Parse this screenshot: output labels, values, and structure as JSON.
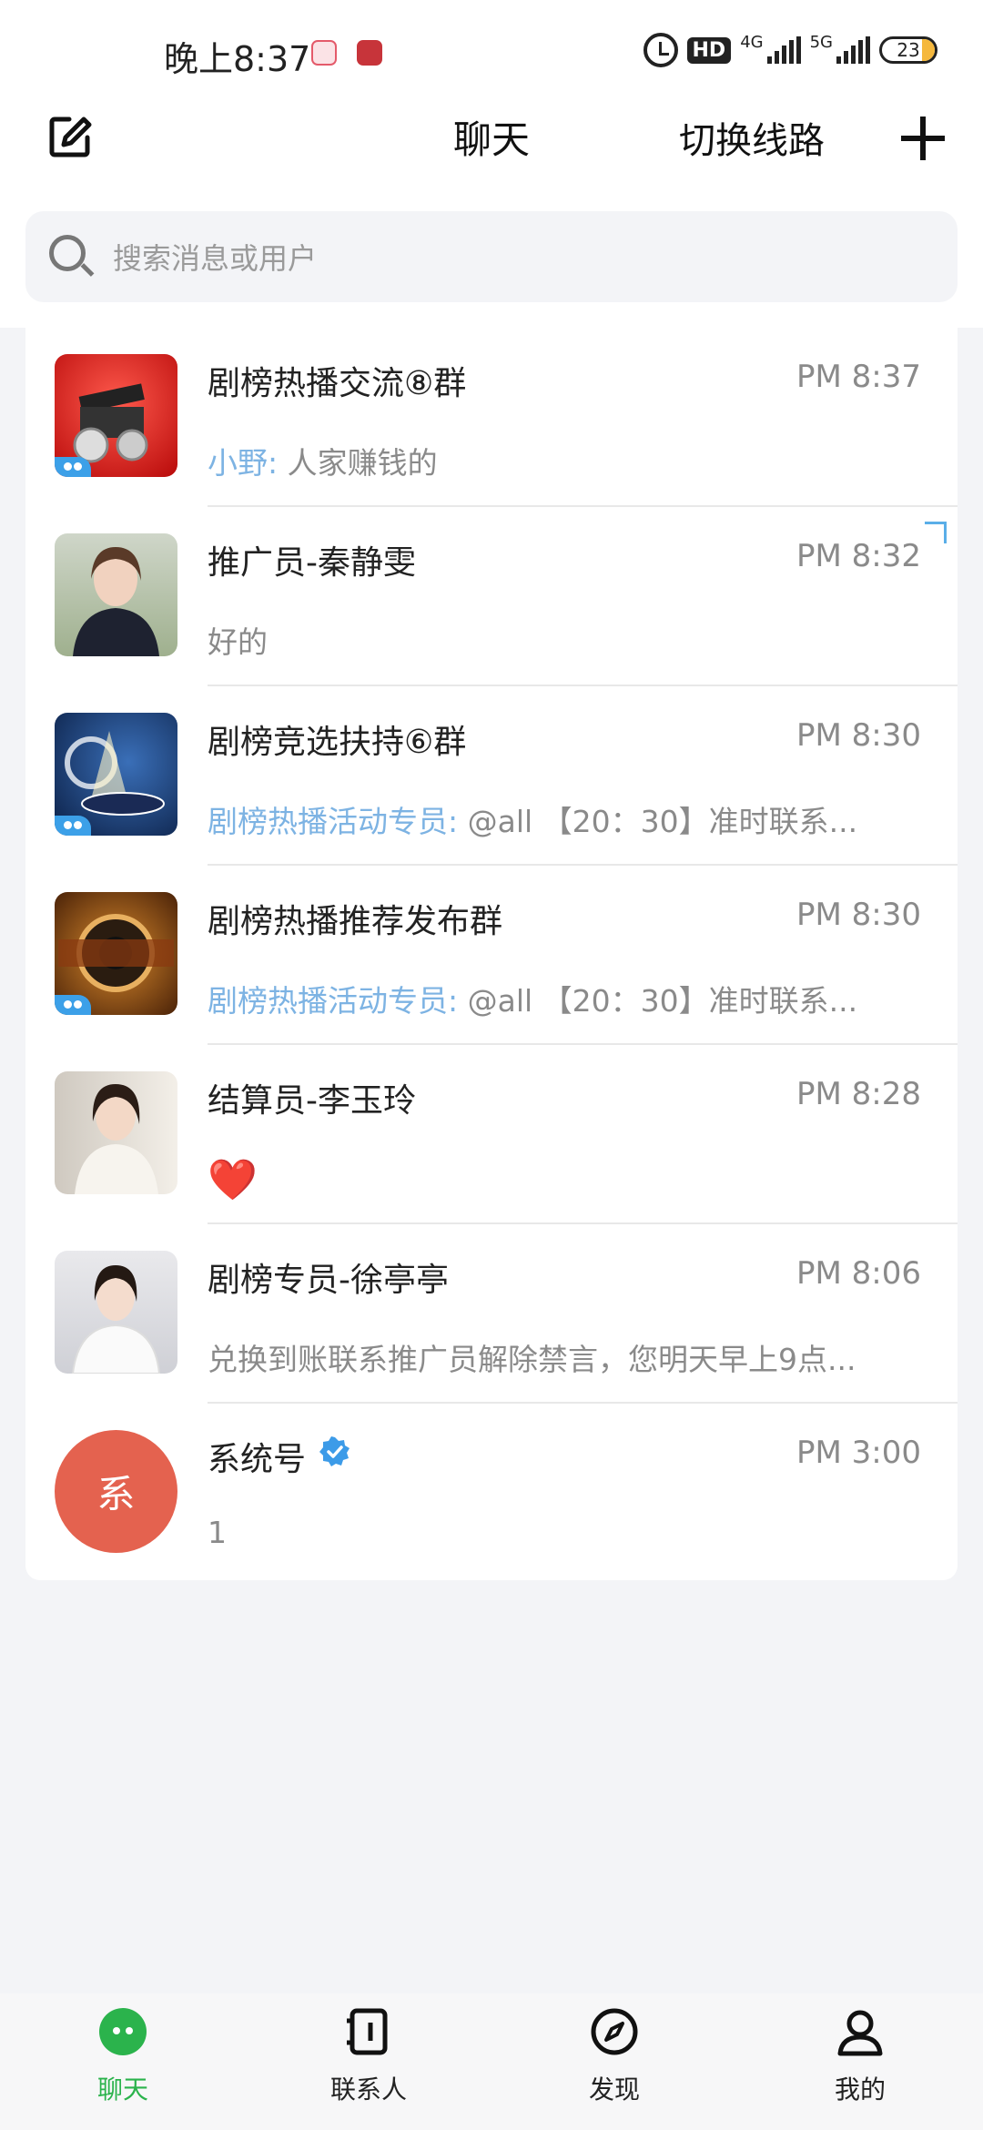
{
  "status_bar": {
    "time": "晚上8:37",
    "hd": "HD",
    "net1": "4G",
    "net2": "5G",
    "battery": "23"
  },
  "header": {
    "title": "聊天",
    "switch_route": "切换线路"
  },
  "search": {
    "placeholder": "搜索消息或用户"
  },
  "chats": [
    {
      "name": "剧榜热播交流⑧群",
      "time": "PM 8:37",
      "sender": "小野: ",
      "preview": "人家赚钱的"
    },
    {
      "name": "推广员-秦静雯",
      "time": "PM 8:32",
      "sender": "",
      "preview": "好的"
    },
    {
      "name": "剧榜竞选扶持⑥群",
      "time": "PM 8:30",
      "sender": "剧榜热播活动专员: ",
      "preview": "@all 【20：30】准时联系..."
    },
    {
      "name": "剧榜热播推荐发布群",
      "time": "PM 8:30",
      "sender": "剧榜热播活动专员: ",
      "preview": "@all 【20：30】准时联系..."
    },
    {
      "name": "结算员-李玉玲",
      "time": "PM 8:28",
      "sender": "",
      "preview": "❤️"
    },
    {
      "name": "剧榜专员-徐亭亭",
      "time": "PM 8:06",
      "sender": "",
      "preview": "兑换到账联系推广员解除禁言，您明天早上9点..."
    },
    {
      "name": "系统号",
      "time": "PM 3:00",
      "sender": "",
      "preview": "1",
      "avatar_text": "系"
    }
  ],
  "bottom_nav": {
    "chat": "聊天",
    "contacts": "联系人",
    "discover": "发现",
    "me": "我的"
  },
  "colors": {
    "accent_green": "#2bb34c",
    "sender_blue": "#7db3e3",
    "system_avatar": "#e4624f"
  }
}
